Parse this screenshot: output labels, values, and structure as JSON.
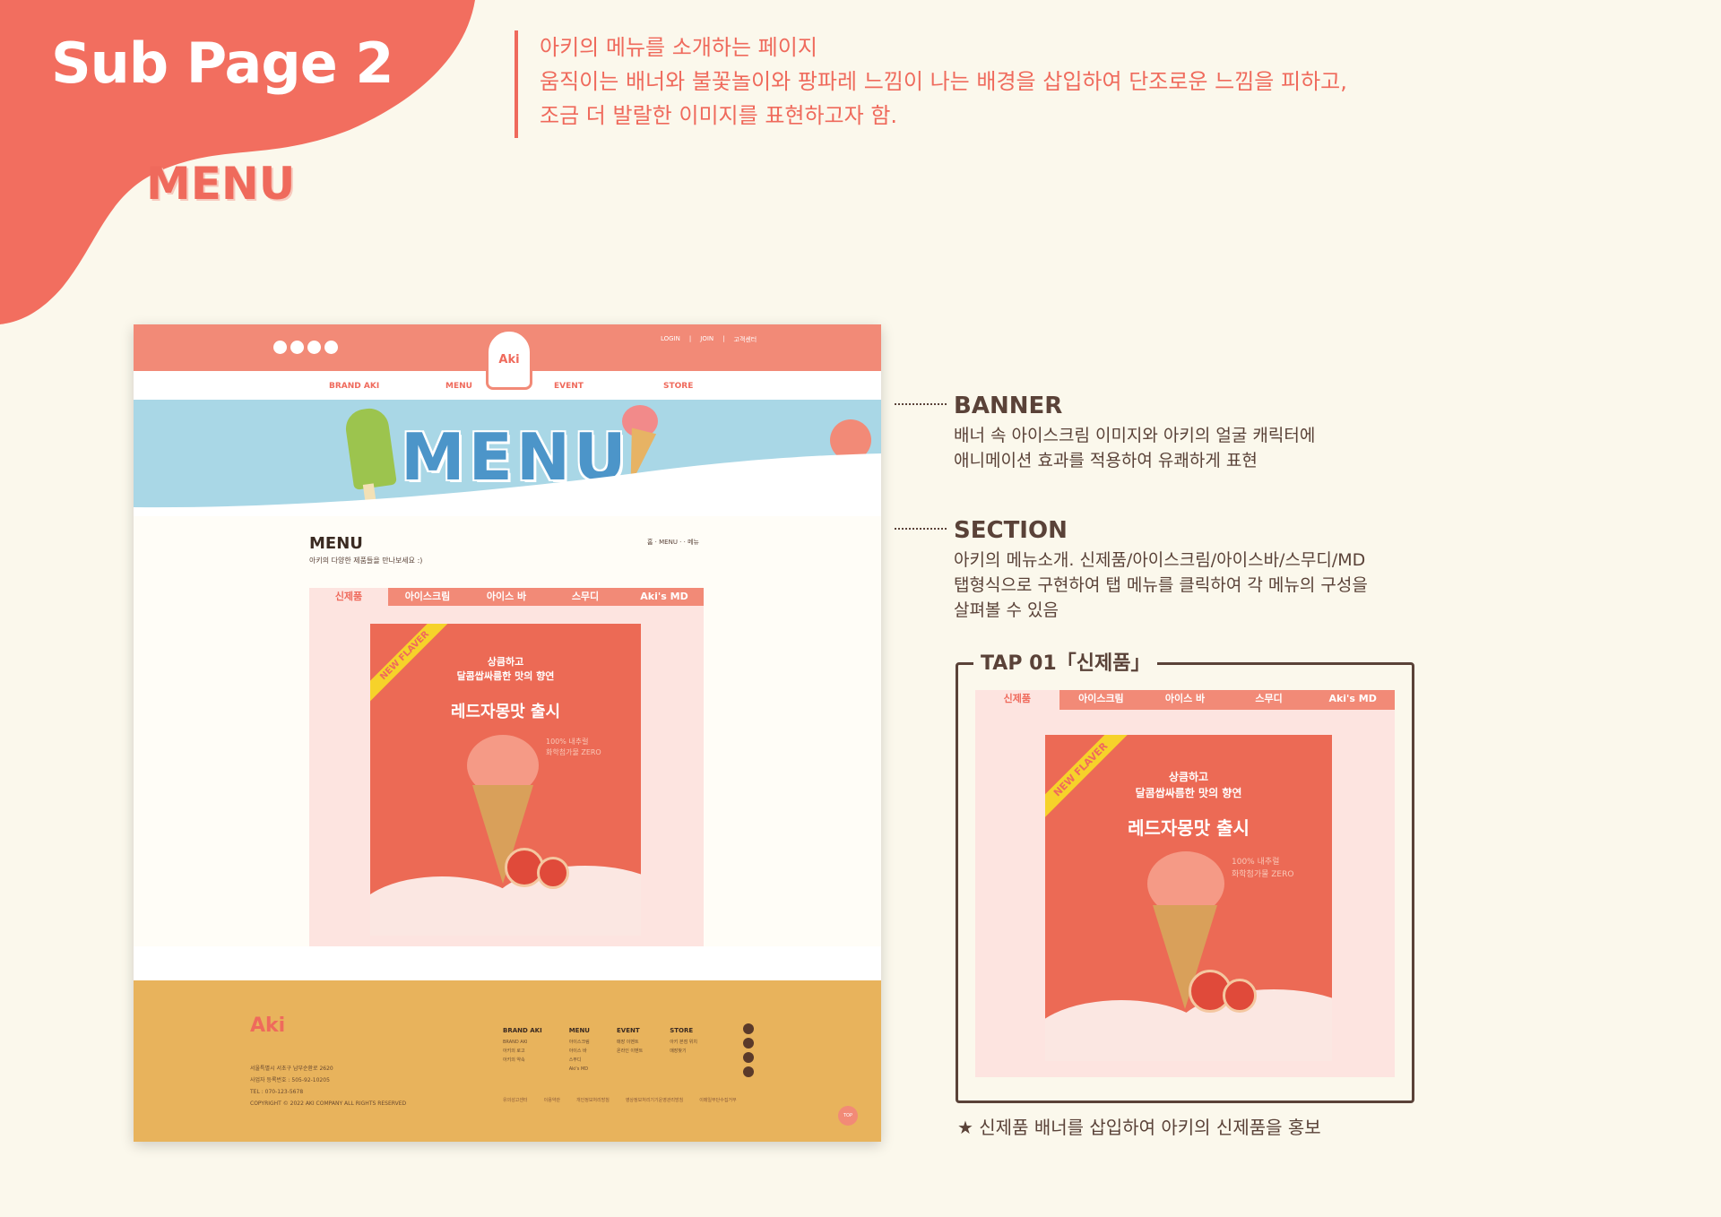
{
  "header": {
    "title": "Sub Page 2",
    "subtitle": "MENU",
    "intro": [
      "아키의 메뉴를 소개하는 페이지",
      "움직이는 배너와 불꽃놀이와 팡파레 느낌이 나는 배경을 삽입하여 단조로운 느낌을 피하고,",
      "조금 더 발랄한 이미지를 표현하고자 함."
    ]
  },
  "mock": {
    "util": [
      "LOGIN",
      "|",
      "JOIN",
      "|",
      "고객센터"
    ],
    "logo": "Aki",
    "nav": [
      "BRAND AKI",
      "MENU",
      "EVENT",
      "STORE"
    ],
    "banner_title": "MENU",
    "section_title": "MENU",
    "section_desc": "아키의 다양한 제품들을 만나보세요 :)",
    "breadcrumb": "홈 · MENU · · 메뉴",
    "tabs": [
      "신제품",
      "아이스크림",
      "아이스 바",
      "스무디",
      "Aki's MD"
    ],
    "product": {
      "ribbon": "NEW FLAVER",
      "line1": "상큼하고",
      "line2": "달콤쌉싸름한 맛의 향연",
      "main": "레드자몽맛 출시",
      "small1": "100% 내추럴",
      "small2": "화학첨가물 ZERO"
    },
    "footer": {
      "logo": "Aki",
      "info": [
        "서울특별시 서초구 남부순환로 2620",
        "사업자 등록번호 : 505-92-10205",
        "TEL : 070-123-5678",
        "COPYRIGHT © 2022 AKI COMPANY ALL RIGHTS RESERVED"
      ],
      "cols": [
        {
          "title": "BRAND AKI",
          "items": [
            "BRAND AKI",
            "아키의 로고",
            "아키의 약속"
          ]
        },
        {
          "title": "MENU",
          "items": [
            "아이스크림",
            "아이스 바",
            "스무디",
            "Aki's MD"
          ]
        },
        {
          "title": "EVENT",
          "items": [
            "매장 이벤트",
            "온라인 이벤트"
          ]
        },
        {
          "title": "STORE",
          "items": [
            "아키 본점 위치",
            "매장찾기"
          ]
        }
      ],
      "links": [
        "유의성고센터",
        "이용약관",
        "개인정보처리방침",
        "영상정보처리기기운영관리방침",
        "이메일무단수집거부"
      ],
      "top": "TOP"
    }
  },
  "callouts": [
    {
      "title": "BANNER",
      "lines": [
        "배너 속 아이스크림 이미지와 아키의 얼굴 캐릭터에",
        "애니메이션 효과를 적용하여 유쾌하게 표현"
      ]
    },
    {
      "title": "SECTION",
      "lines": [
        "아키의 메뉴소개. 신제품/아이스크림/아이스바/스무디/MD",
        "탭형식으로 구현하여 탭 메뉴를 클릭하여 각 메뉴의 구성을",
        "살펴볼 수 있음"
      ]
    }
  ],
  "tap": {
    "label": "TAP 01「신제품」",
    "note": "★ 신제품 배너를 삽입하여 아키의 신제품을 홍보"
  },
  "colors": {
    "accent": "#ef6a5c",
    "bg": "#fbf8ec",
    "footer": "#e8b35c",
    "banner": "#a9d7e6"
  }
}
